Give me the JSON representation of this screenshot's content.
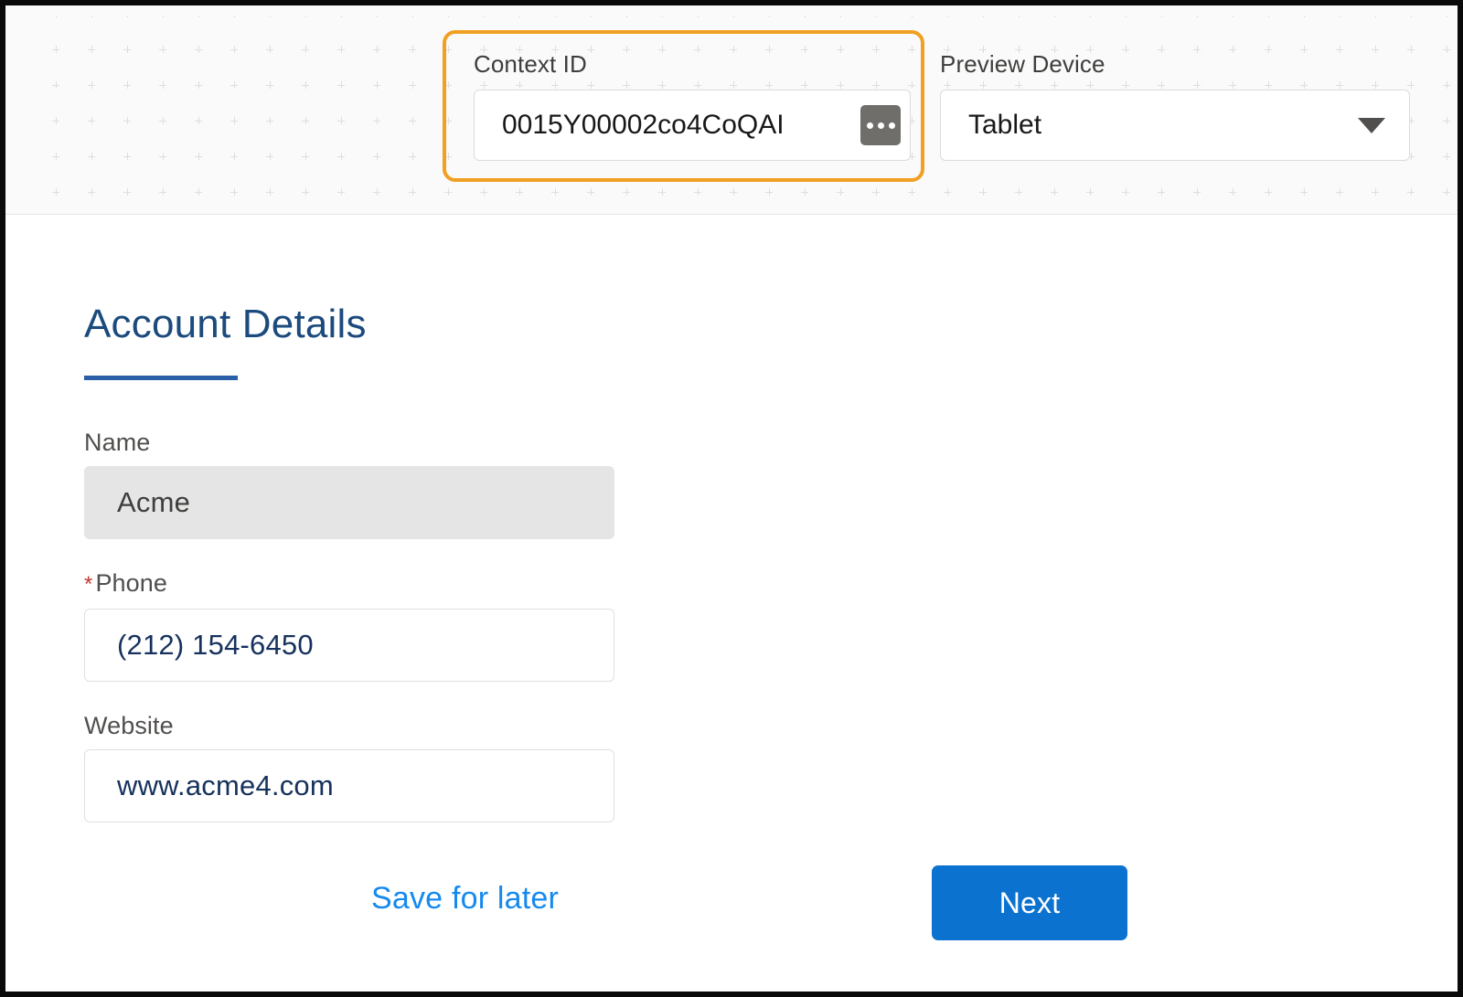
{
  "builder_bar": {
    "context_id": {
      "label": "Context ID",
      "value": "0015Y00002co4CoQAI",
      "more_button_icon": "ellipsis-icon"
    },
    "preview_device": {
      "label": "Preview Device",
      "selected": "Tablet",
      "caret_icon": "chevron-down-icon"
    },
    "highlight_color": "#f0a023"
  },
  "form": {
    "section_title": "Account Details",
    "fields": [
      {
        "label": "Name",
        "value": "Acme",
        "required": false,
        "readonly": true
      },
      {
        "label": "Phone",
        "value": "(212) 154-6450",
        "required": true,
        "readonly": false,
        "required_marker": "*"
      },
      {
        "label": "Website",
        "value": "www.acme4.com",
        "required": false,
        "readonly": false
      }
    ]
  },
  "actions": {
    "save_label": "Save for later",
    "next_label": "Next",
    "link_color": "#1589ee",
    "primary_color": "#0b73cf"
  }
}
